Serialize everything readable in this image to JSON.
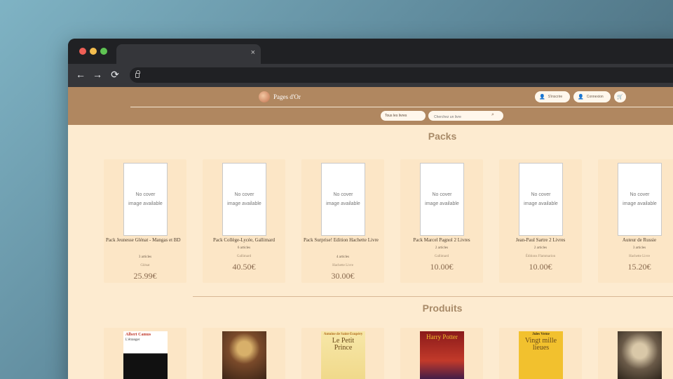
{
  "browser": {
    "tab_close": "×",
    "nav": {
      "back": "←",
      "forward": "→",
      "reload": "⟳"
    }
  },
  "header": {
    "brand": "Pages d'Or",
    "signup": "S'inscrire",
    "login": "Connexion",
    "category_select": "Tous les livres",
    "search_placeholder": "Cherchez un livre"
  },
  "packs": {
    "title": "Packs",
    "items": [
      {
        "cover_text": "No cover image available",
        "title": "Pack Jeunesse Glénat - Mangas et BD",
        "count": "3 articles",
        "publisher": "Glénat",
        "price": "25.99€"
      },
      {
        "cover_text": "No cover image available",
        "title": "Pack Collège-Lycée, Gallimard",
        "count": "6 articles",
        "publisher": "Gallimard",
        "price": "40.50€"
      },
      {
        "cover_text": "No cover image available",
        "title": "Pack Surprise! Edition Hachette Livre",
        "count": "4 articles",
        "publisher": "Hachette Livre",
        "price": "30.00€"
      },
      {
        "cover_text": "No cover image available",
        "title": "Pack Marcel Pagnol 2 Livres",
        "count": "2 articles",
        "publisher": "Gallimard",
        "price": "10.00€"
      },
      {
        "cover_text": "No cover image available",
        "title": "Jean-Paul Sartre 2 Livres",
        "count": "2 articles",
        "publisher": "Éditions Flammarion",
        "price": "10.00€"
      },
      {
        "cover_text": "No cover image available",
        "title": "Auteur de Russie",
        "count": "3 articles",
        "publisher": "Hachette Livre",
        "price": "15.20€"
      }
    ]
  },
  "products": {
    "title": "Produits",
    "items": [
      {
        "cover_author": "Albert Camus",
        "cover_title": "L'étranger"
      },
      {
        "cover_author": "",
        "cover_title": ""
      },
      {
        "cover_author": "Antoine de Saint-Exupéry",
        "cover_title": "Le Petit Prince"
      },
      {
        "cover_author": "",
        "cover_title": "Harry Potter"
      },
      {
        "cover_author": "Jules Verne",
        "cover_title": "Vingt mille lieues"
      },
      {
        "cover_author": "",
        "cover_title": ""
      }
    ]
  },
  "colors": {
    "header": "#b08760",
    "page": "#fdebd0",
    "card": "#fce6c6",
    "accent": "#a88a68"
  }
}
